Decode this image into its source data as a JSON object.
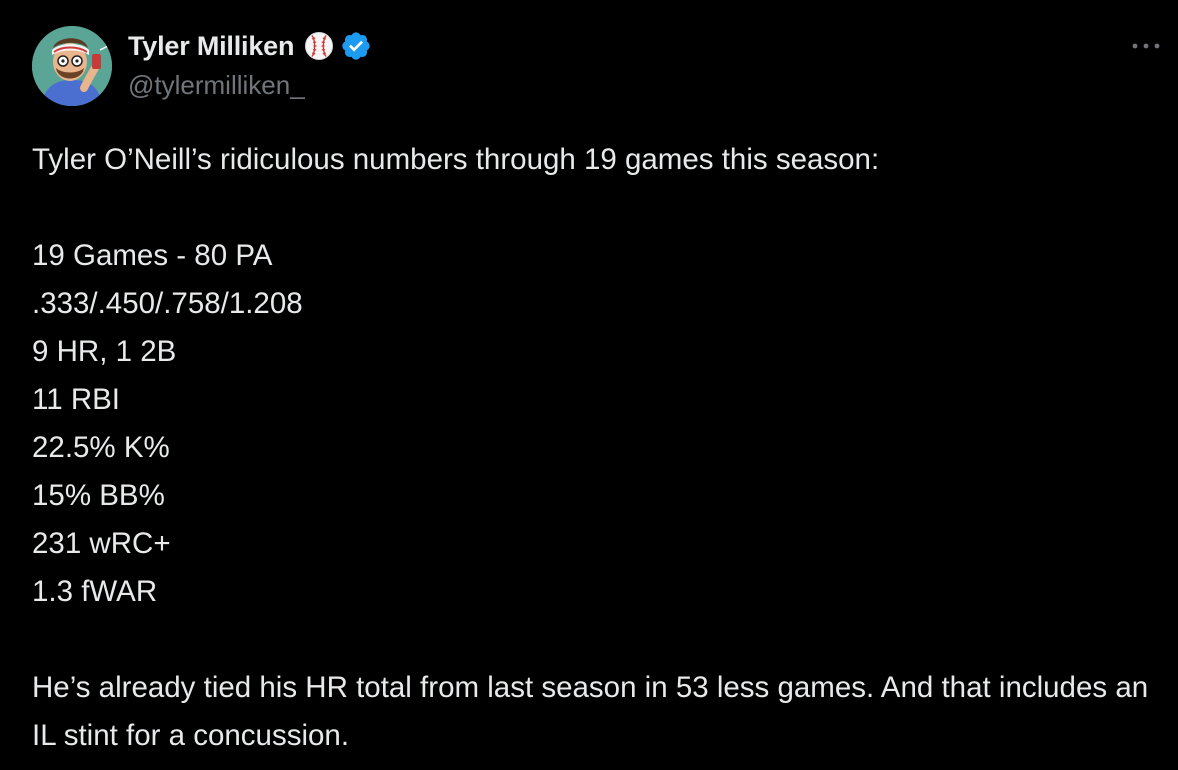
{
  "tweet": {
    "author": {
      "display_name": "Tyler Milliken",
      "handle": "@tylermilliken_",
      "name_emoji": "baseball-icon",
      "verified": true,
      "verified_color": "#1d9bf0"
    },
    "menu_icon": "more-horizontal-icon",
    "intro": "Tyler O’Neill’s ridiculous numbers through 19 games this season:",
    "stats": [
      "19 Games - 80 PA",
      ".333/.450/.758/1.208",
      "9 HR, 1 2B",
      "11 RBI",
      "22.5% K%",
      "15% BB%",
      "231 wRC+",
      "1.3 fWAR"
    ],
    "closing": "He’s already tied his HR total from last season in 53 less games. And that includes an IL stint for a concussion."
  },
  "colors": {
    "background": "#000000",
    "text": "#e7e9ea",
    "secondary_text": "#71767b",
    "accent": "#1d9bf0"
  }
}
